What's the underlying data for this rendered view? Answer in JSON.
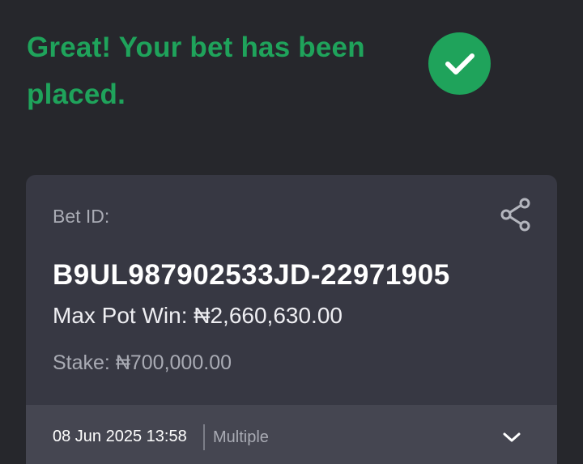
{
  "confirmation": {
    "title": "Great! Your bet has been placed.",
    "status_icon": "check-circle-icon",
    "accent_color": "#1fa35b"
  },
  "bet": {
    "id_label": "Bet ID:",
    "id_value": "B9UL987902533JD-22971905",
    "share_icon": "share-icon",
    "max_pot_win": "Max Pot Win: ₦2,660,630.00",
    "stake": "Stake: ₦700,000.00",
    "date": "08 Jun 2025 13:58",
    "type": "Multiple",
    "expand_icon": "chevron-down-icon"
  }
}
